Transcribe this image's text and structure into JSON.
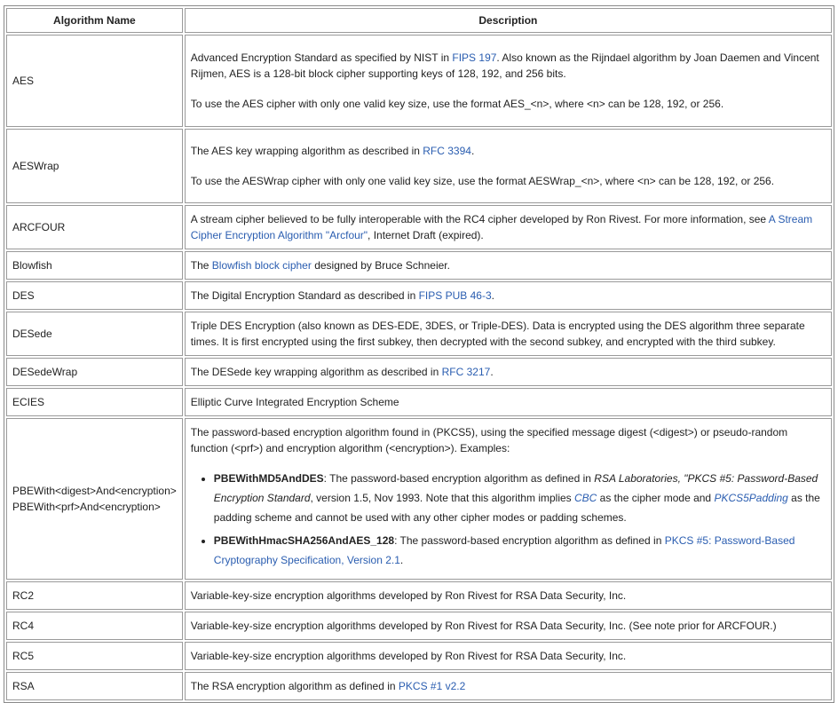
{
  "headers": {
    "name": "Algorithm Name",
    "description": "Description"
  },
  "rows": {
    "aes": {
      "name": "AES",
      "p1_a": "Advanced Encryption Standard as specified by NIST in ",
      "p1_link": "FIPS 197",
      "p1_b": ". Also known as the Rijndael algorithm by Joan Daemen and Vincent Rijmen, AES is a 128-bit block cipher supporting keys of 128, 192, and 256 bits.",
      "p2": "To use the AES cipher with only one valid key size, use the format AES_<n>, where <n> can be 128, 192, or 256."
    },
    "aeswrap": {
      "name": "AESWrap",
      "p1_a": "The AES key wrapping algorithm as described in ",
      "p1_link": "RFC 3394",
      "p1_b": ".",
      "p2": "To use the AESWrap cipher with only one valid key size, use the format AESWrap_<n>, where <n> can be 128, 192, or 256."
    },
    "arcfour": {
      "name": "ARCFOUR",
      "a": "A stream cipher believed to be fully interoperable with the RC4 cipher developed by Ron Rivest. For more information, see ",
      "link": "A Stream Cipher Encryption Algorithm \"Arcfour\"",
      "b": ", Internet Draft (expired)."
    },
    "blowfish": {
      "name": "Blowfish",
      "a": "The ",
      "link": "Blowfish block cipher",
      "b": " designed by Bruce Schneier."
    },
    "des": {
      "name": "DES",
      "a": "The Digital Encryption Standard as described in ",
      "link": "FIPS PUB 46-3",
      "b": "."
    },
    "desede": {
      "name": "DESede",
      "text": "Triple DES Encryption (also known as DES-EDE, 3DES, or Triple-DES). Data is encrypted using the DES algorithm three separate times. It is first encrypted using the first subkey, then decrypted with the second subkey, and encrypted with the third subkey."
    },
    "desedewrap": {
      "name": "DESedeWrap",
      "a": "The DESede key wrapping algorithm as described in ",
      "link": "RFC 3217",
      "b": "."
    },
    "ecies": {
      "name": "ECIES",
      "text": "Elliptic Curve Integrated Encryption Scheme"
    },
    "pbe": {
      "name_line1": "PBEWith<digest>And<encryption>",
      "name_line2": "PBEWith<prf>And<encryption>",
      "intro": "The password-based encryption algorithm found in (PKCS5), using the specified message digest (<digest>) or pseudo-random function (<prf>) and encryption algorithm (<encryption>). Examples:",
      "ex1_bold": "PBEWithMD5AndDES",
      "ex1_a": ": The password-based encryption algorithm as defined in ",
      "ex1_em": "RSA Laboratories, \"PKCS #5: Password-Based Encryption Standard",
      "ex1_b": ", version 1.5, Nov 1993. Note that this algorithm implies ",
      "ex1_link1": "CBC",
      "ex1_c": " as the cipher mode and ",
      "ex1_link2": "PKCS5Padding",
      "ex1_d": " as the padding scheme and cannot be used with any other cipher modes or padding schemes.",
      "ex2_bold": "PBEWithHmacSHA256AndAES_128",
      "ex2_a": ": The password-based encryption algorithm as defined in ",
      "ex2_link": "PKCS #5: Password-Based Cryptography Specification, Version 2.1",
      "ex2_b": "."
    },
    "rc2": {
      "name": "RC2",
      "text": "Variable-key-size encryption algorithms developed by Ron Rivest for RSA Data Security, Inc."
    },
    "rc4": {
      "name": "RC4",
      "text": "Variable-key-size encryption algorithms developed by Ron Rivest for RSA Data Security, Inc. (See note prior for ARCFOUR.)"
    },
    "rc5": {
      "name": "RC5",
      "text": "Variable-key-size encryption algorithms developed by Ron Rivest for RSA Data Security, Inc."
    },
    "rsa": {
      "name": "RSA",
      "a": "The RSA encryption algorithm as defined in ",
      "link": "PKCS #1 v2.2"
    }
  }
}
